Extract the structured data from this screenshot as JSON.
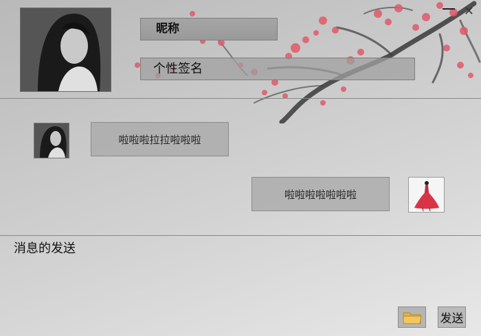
{
  "profile": {
    "nickname": "昵称",
    "signature": "个性签名"
  },
  "window_controls": {
    "close_glyph": "✕"
  },
  "messages": [
    {
      "side": "left",
      "text": "啦啦啦拉拉啦啦啦"
    },
    {
      "side": "right",
      "text": "啦啦啦啦啦啦啦"
    }
  ],
  "compose": {
    "label": "消息的发送",
    "send_label": "发送"
  },
  "icons": {
    "folder": "folder-icon",
    "minimize": "minimize-icon",
    "close": "close-icon"
  },
  "colors": {
    "blossom": "#e05a6a",
    "branch": "#3a3a3a",
    "background": "#c9c9c9"
  }
}
